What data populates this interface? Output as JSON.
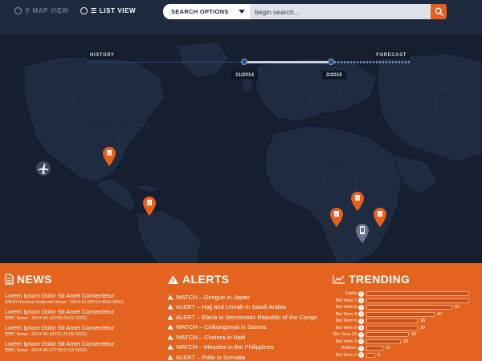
{
  "topbar": {
    "map_view_label": "MAP VIEW",
    "list_view_label": "LIST VIEW",
    "search_options_label": "SEARCH OPTIONS",
    "search_placeholder": "begin search..."
  },
  "timeline": {
    "history_label": "HISTORY",
    "forecast_label": "FORECAST",
    "start_date": "11/2014",
    "end_date": "2/2015"
  },
  "news": {
    "heading": "NEWS",
    "items": [
      {
        "title": "Lorem Ipsum Dolor Sit Amet Consectetur",
        "meta": "(WHO Disease Outbreak News - 2014-10-09T13:4500.000Z)"
      },
      {
        "title": "Lorem Ipsum Dolor Sit Amet Consectetur",
        "meta": "(BBC News - 2014-09-16T08:29:52.000Z)"
      },
      {
        "title": "Lorem Ipsum Dolor Sit Amet Consectetur",
        "meta": "(BBC News - 2014-06-16T01:25:05.000Z)"
      },
      {
        "title": "Lorem Ipsum Dolor Sit Amet Consectetur",
        "meta": "(BBC News - 2014-06-27T18:57:03.000Z)"
      }
    ]
  },
  "alerts": {
    "heading": "ALERTS",
    "items": [
      "WATCH – Dengue in Japan",
      "ALERT – Hajj and Umrah in Saudi Arabia",
      "ALERT – Ebola in Democratic Republic of the Congo",
      "WATCH – Chikungunya in Samoa",
      "WATCH – Cholera in Haiti",
      "WATCH – Measles in the Philippines",
      "ALERT – Polio in Somalia"
    ]
  },
  "trending": {
    "heading": "TRENDING",
    "max": 60,
    "items": [
      {
        "label": "Ebola",
        "value": 60,
        "value_label": ""
      },
      {
        "label": "Bio Term 7",
        "value": 60,
        "value_label": ""
      },
      {
        "label": "Bio Term 8",
        "value": 50,
        "value_label": "50"
      },
      {
        "label": "Bio Term 4",
        "value": 40,
        "value_label": "40"
      },
      {
        "label": "Bio Term 6",
        "value": 30,
        "value_label": "30"
      },
      {
        "label": "Bio Term 9",
        "value": 30,
        "value_label": "30"
      },
      {
        "label": "Bio Term 10",
        "value": 25,
        "value_label": "25"
      },
      {
        "label": "Bio Term 3",
        "value": 20,
        "value_label": "20"
      },
      {
        "label": "Anthrax",
        "value": 10,
        "value_label": "10"
      },
      {
        "label": "Bio Term 2",
        "value": 5,
        "value_label": "5"
      }
    ]
  },
  "colors": {
    "accent": "#e8601c",
    "panel": "#e4641f",
    "map_bg": "#151f30",
    "land": "#1f2b40"
  },
  "icons": {
    "map_view": "map-pin-icon",
    "list_view": "list-icon",
    "search": "search-icon",
    "news": "document-icon",
    "alerts": "warning-triangle-icon",
    "trending": "trend-line-icon",
    "map_marker": "orange-document-pin-icon",
    "plane": "airplane-icon",
    "device": "mobile-device-pin-icon"
  }
}
